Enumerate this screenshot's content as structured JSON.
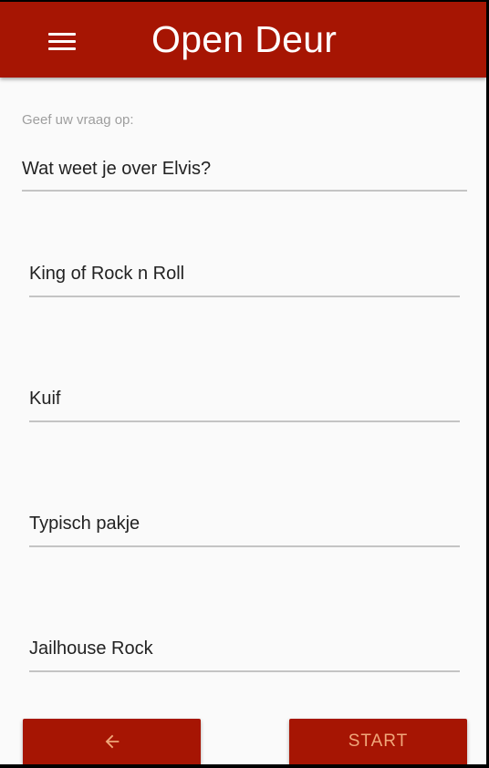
{
  "appbar": {
    "title": "Open Deur",
    "menu_icon": "menu-icon"
  },
  "question": {
    "label": "Geef uw vraag op:",
    "value": "Wat weet je over Elvis?"
  },
  "answers": [
    {
      "value": "King of Rock n Roll"
    },
    {
      "value": "Kuif"
    },
    {
      "value": "Typisch pakje"
    },
    {
      "value": "Jailhouse Rock"
    }
  ],
  "buttons": {
    "back_icon": "arrow-left-icon",
    "start_label": "START"
  },
  "colors": {
    "primary": "#a61503",
    "button_text": "#f0a77a",
    "background": "#fafafa"
  }
}
